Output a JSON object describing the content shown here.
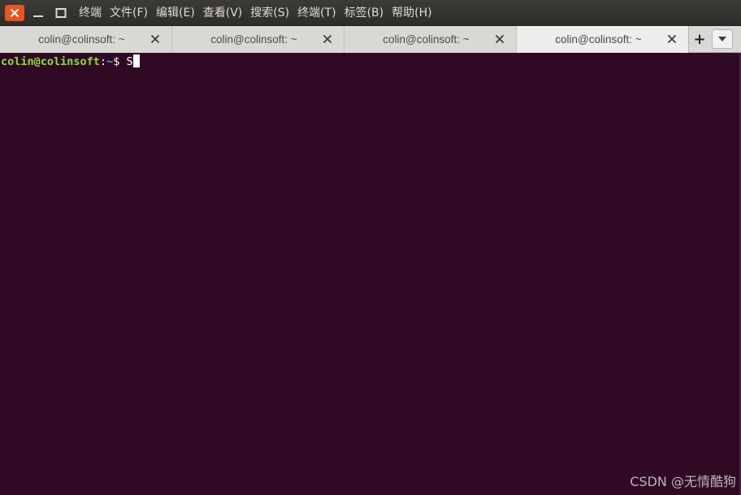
{
  "window": {
    "icons": [
      "close-icon",
      "minimize-icon",
      "maximize-icon"
    ],
    "accent_color": "#e95420"
  },
  "menubar": {
    "items": [
      {
        "label": "终端"
      },
      {
        "label": "文件(F)"
      },
      {
        "label": "编辑(E)"
      },
      {
        "label": "查看(V)"
      },
      {
        "label": "搜索(S)"
      },
      {
        "label": "终端(T)"
      },
      {
        "label": "标签(B)"
      },
      {
        "label": "帮助(H)"
      }
    ]
  },
  "tabs": [
    {
      "label": "colin@colinsoft: ~",
      "active": false
    },
    {
      "label": "colin@colinsoft: ~",
      "active": false
    },
    {
      "label": "colin@colinsoft: ~",
      "active": false
    },
    {
      "label": "colin@colinsoft: ~",
      "active": true
    }
  ],
  "tabbar": {
    "new_tab_label": "+",
    "menu_icon": "chevron-down-icon"
  },
  "terminal": {
    "prompt_user": "colin@colinsoft",
    "prompt_colon": ":",
    "prompt_path": "~",
    "prompt_dollar": "$ ",
    "input": "S",
    "background": "#300a24",
    "user_color": "#8ae234",
    "path_color": "#729fcf"
  },
  "watermark": {
    "text": "CSDN @无情酷狗"
  }
}
